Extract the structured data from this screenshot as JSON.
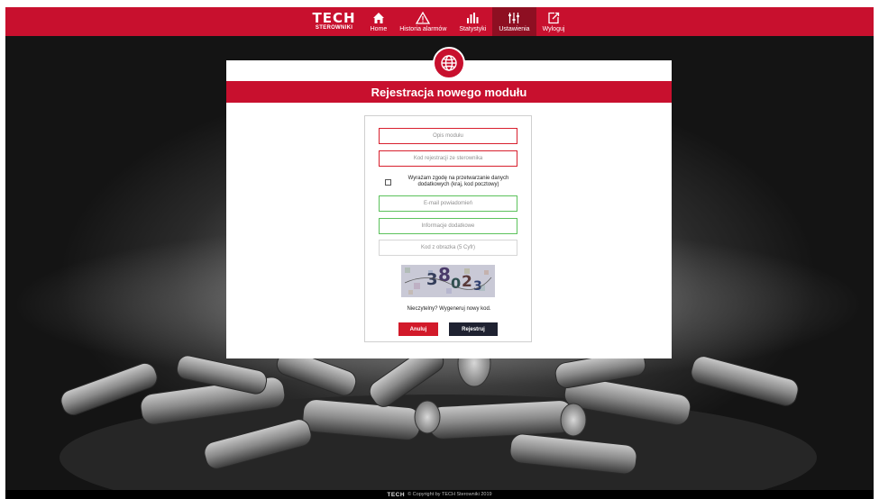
{
  "nav": {
    "brand": "TECH",
    "brand_sub": "STEROWNIKI",
    "items": [
      {
        "label": "Home",
        "icon": "home-icon"
      },
      {
        "label": "Historia alarmów",
        "icon": "warning-icon"
      },
      {
        "label": "Statystyki",
        "icon": "bar-chart-icon"
      },
      {
        "label": "Ustawienia",
        "icon": "sliders-icon",
        "active": true
      },
      {
        "label": "Wyloguj",
        "icon": "logout-icon"
      }
    ]
  },
  "modal": {
    "icon": "globe-icon",
    "title": "Rejestracja nowego modułu",
    "fields": {
      "description": {
        "placeholder": "Opis modułu"
      },
      "reg_code": {
        "placeholder": "Kod rejestracji ze sterownika"
      },
      "email": {
        "placeholder": "E-mail powiadomień"
      },
      "extra": {
        "placeholder": "Informacje dodatkowe"
      },
      "captcha_code": {
        "placeholder": "Kod z obrazka (5 Cyfr)"
      }
    },
    "consent": "Wyrażam zgodę na przetwarzanie danych dodatkowych (kraj, kod pocztowy)",
    "consent_checked": false,
    "captcha_text": "38023",
    "refresh_text": "Nieczytelny? Wygeneruj nowy kod.",
    "cancel_label": "Anuluj",
    "submit_label": "Rejestruj"
  },
  "footer": {
    "brand": "TECH",
    "copyright": "© Copyright by TECH Sterowniki 2019"
  },
  "colors": {
    "accent": "#c8102e",
    "nav_active": "#8e0f22",
    "submit_button": "#1f2231",
    "field_error_border": "#d8202e",
    "field_ok_border": "#5cc25c"
  }
}
